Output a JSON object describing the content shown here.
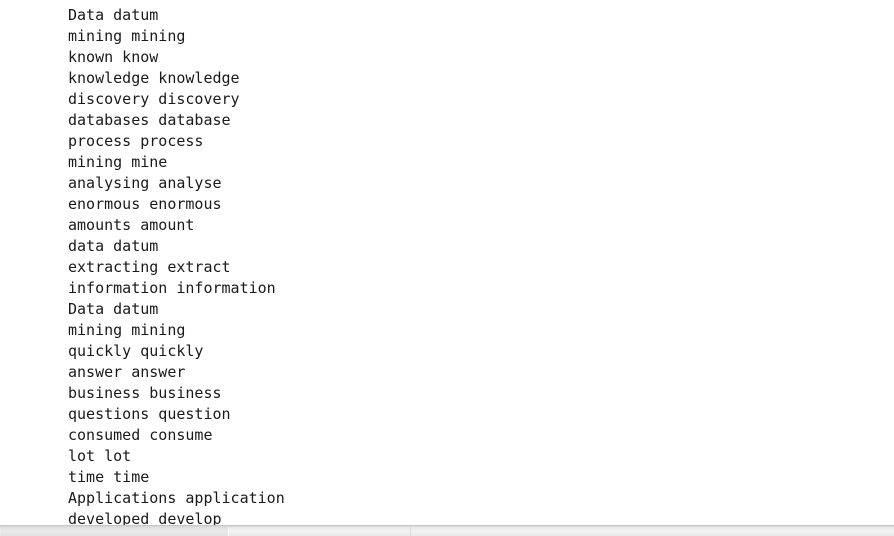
{
  "console": {
    "title": "console-output",
    "background_color": "#ffffff",
    "text_color": "#1a1a1a",
    "lines": [
      "Data datum",
      "mining mining",
      "known know",
      "knowledge knowledge",
      "discovery discovery",
      "databases database",
      "process process",
      "mining mine",
      "analysing analyse",
      "enormous enormous",
      "amounts amount",
      "data datum",
      "extracting extract",
      "information information",
      "Data datum",
      "mining mining",
      "quickly quickly",
      "answer answer",
      "business business",
      "questions question",
      "consumed consume",
      "lot lot",
      "time time",
      "Applications application",
      "developed develop"
    ]
  },
  "scrollbar": {
    "orientation": "horizontal",
    "thumb_label": "horizontal-scroll-thumb",
    "track_color": "#ececec",
    "thumb_color": "#e4e4e4"
  }
}
